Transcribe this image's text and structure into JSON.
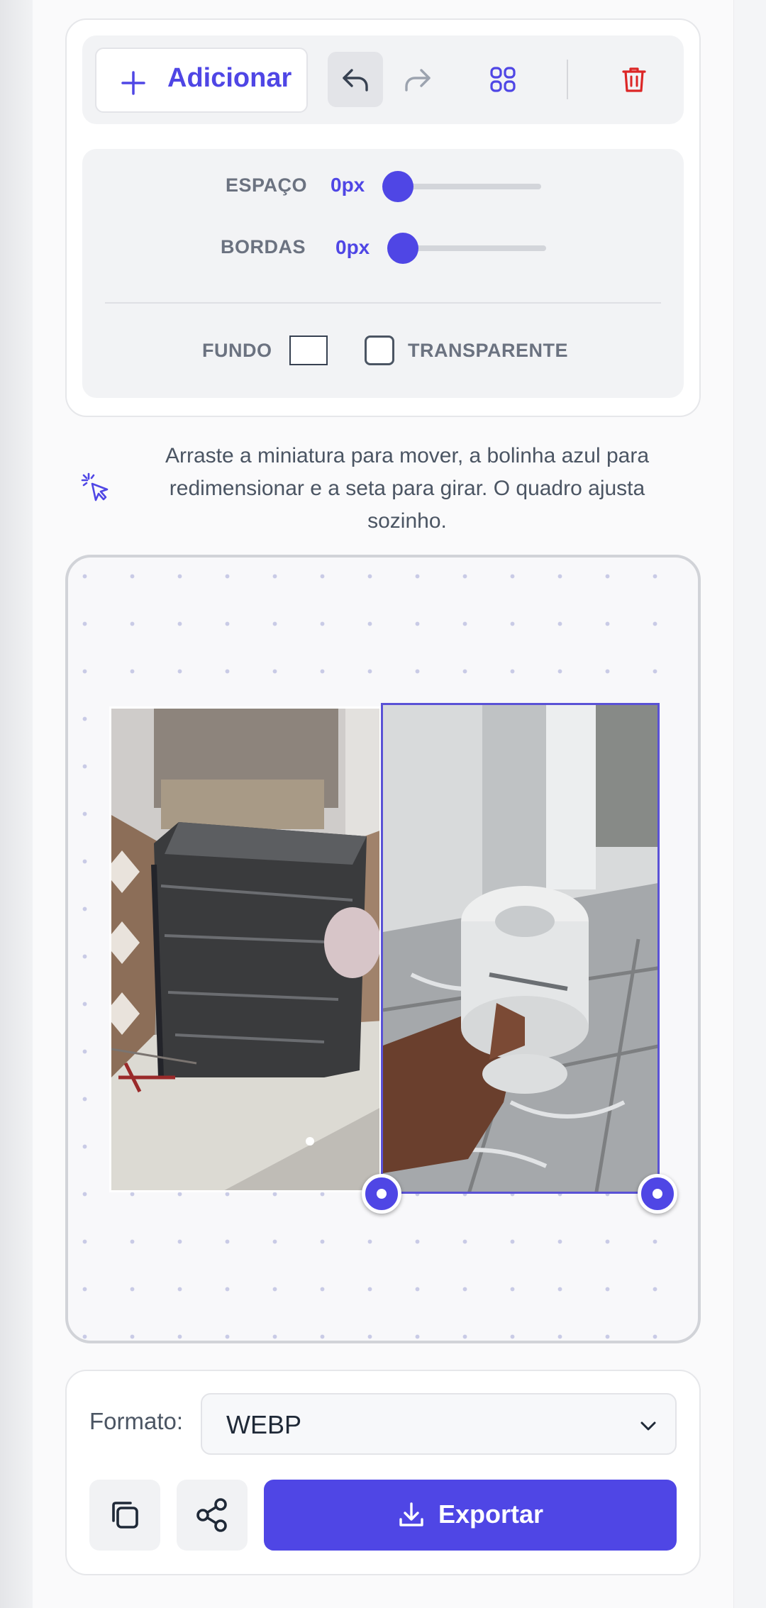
{
  "toolbar": {
    "add_label": "Adicionar",
    "icons": [
      "plus-icon",
      "undo-icon",
      "redo-icon",
      "grid-icon",
      "trash-icon"
    ]
  },
  "settings": {
    "spacing_label": "ESPAÇO",
    "spacing_value": "0px",
    "spacing_level": 0,
    "borders_label": "BORDAS",
    "borders_value": "0px",
    "borders_level": 0,
    "background_label": "FUNDO",
    "background_color": "#ffffff",
    "transparent_label": "TRANSPARENTE",
    "transparent_checked": false
  },
  "hint": {
    "icon": "pointer-click-icon",
    "text": "Arraste a miniatura para mover, a bolinha azul para redimensionar e a seta para girar. O quadro ajusta sozinho."
  },
  "export_panel": {
    "format_label": "Formato:",
    "format_value": "WEBP",
    "export_label": "Exportar",
    "icons": [
      "copy-icon",
      "share-icon",
      "download-icon",
      "chevron-down-icon"
    ]
  },
  "colors": {
    "accent": "#4f46e5",
    "danger": "#dc2626",
    "text_muted": "#6b7280"
  }
}
